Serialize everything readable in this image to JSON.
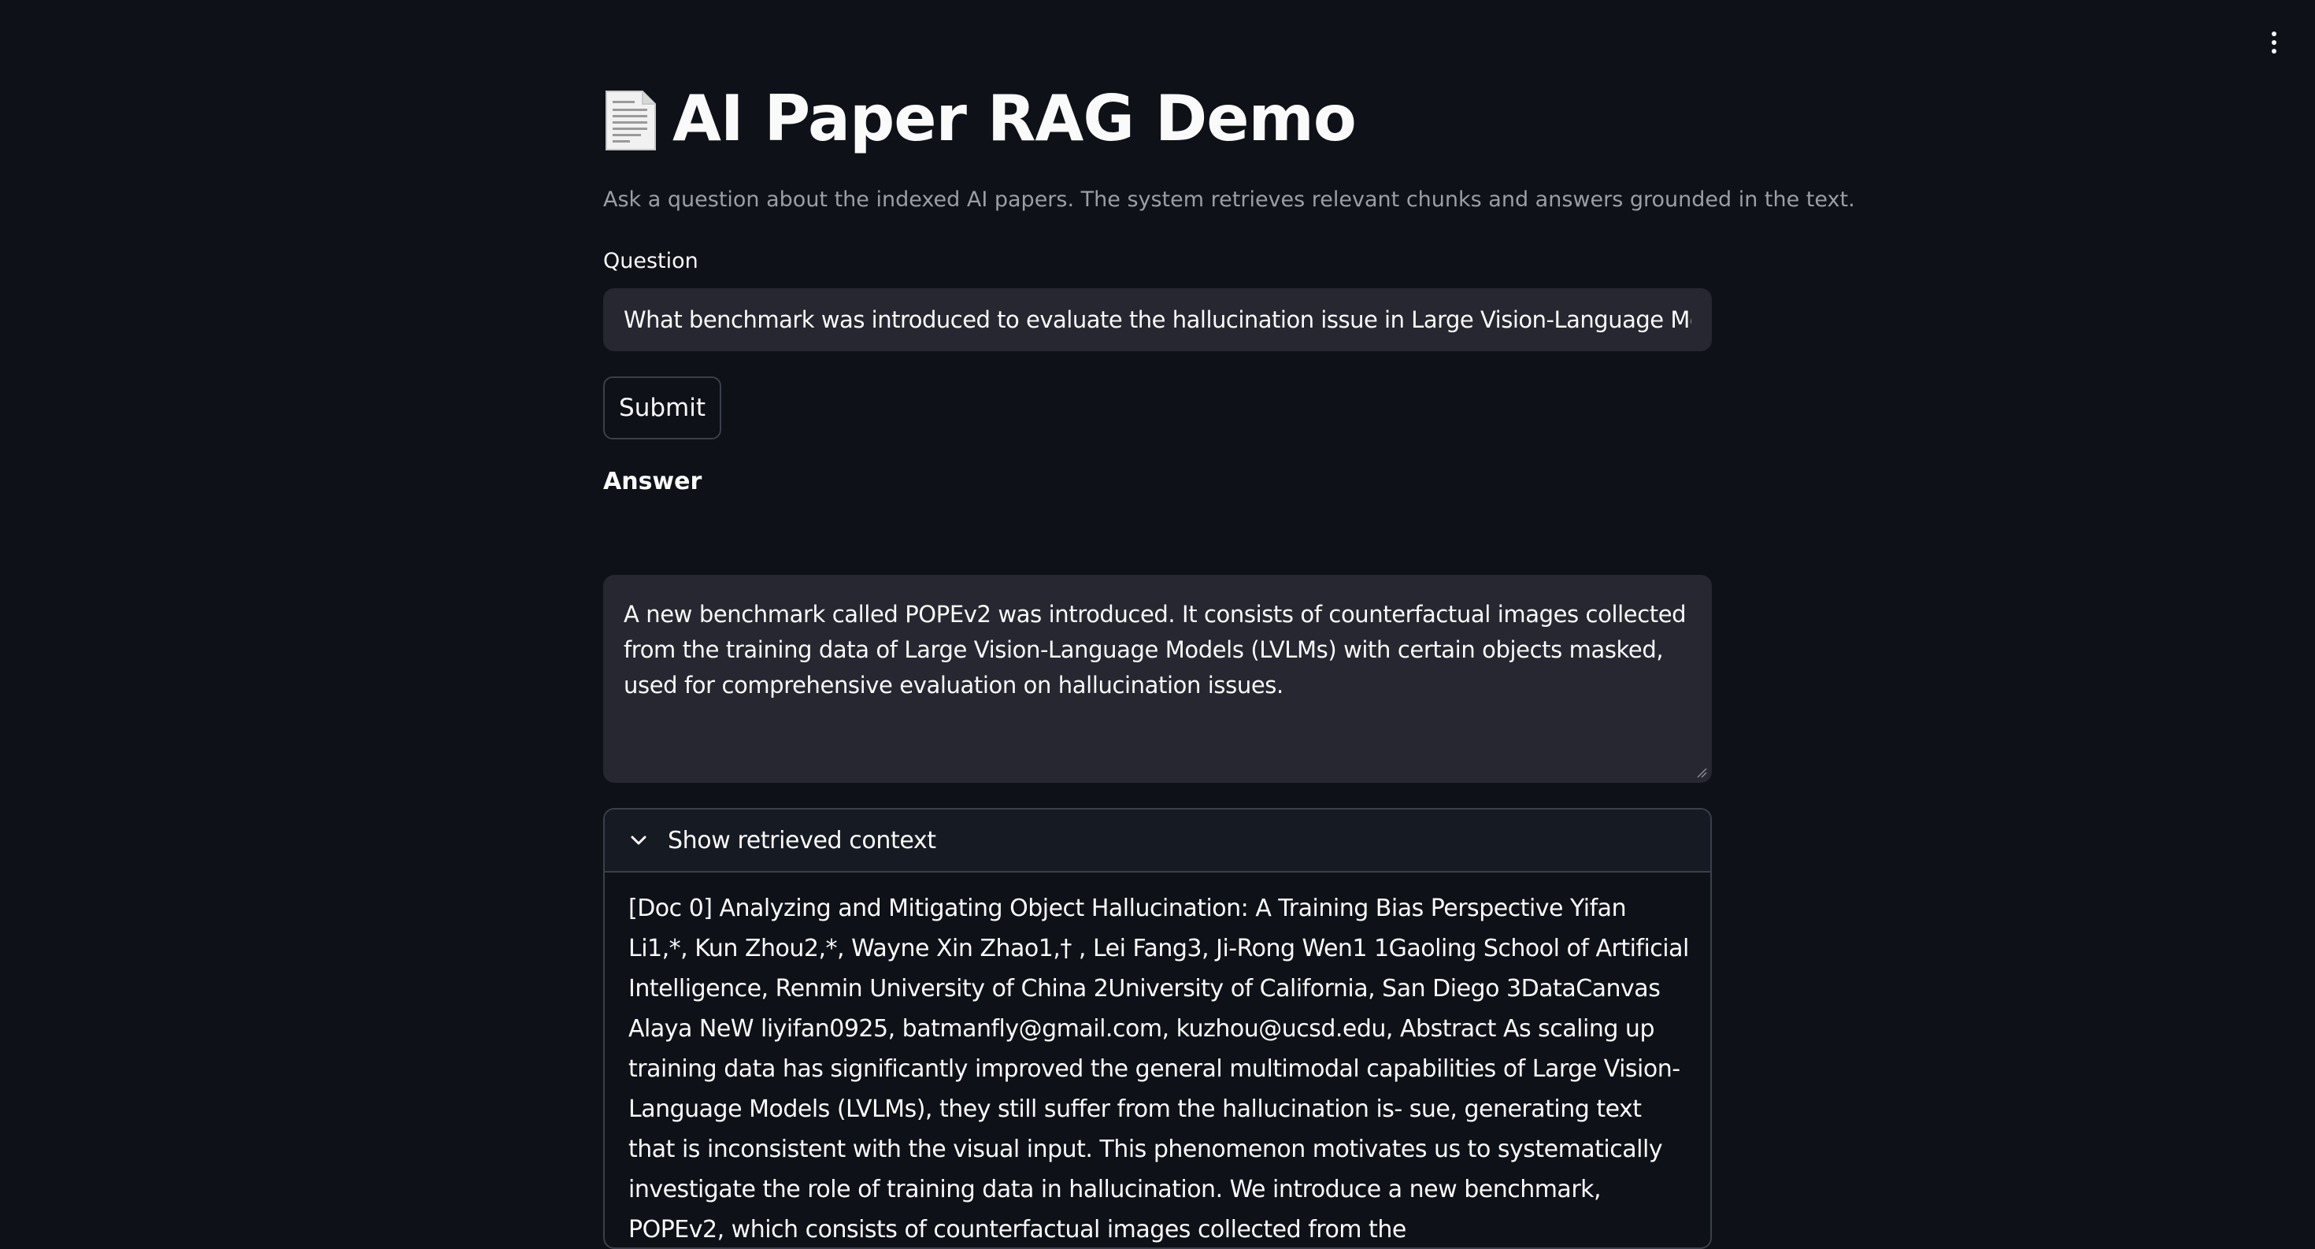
{
  "app": {
    "title": "AI Paper RAG Demo",
    "title_icon": "page-facing-up-icon",
    "subtitle": "Ask a question about the indexed AI papers. The system retrieves relevant chunks and answers grounded in the text.",
    "menu_icon": "vertical-ellipsis-icon"
  },
  "question": {
    "label": "Question",
    "value": "What benchmark was introduced to evaluate the hallucination issue in Large Vision-Language Models?"
  },
  "submit": {
    "label": "Submit"
  },
  "answer": {
    "heading": "Answer",
    "text": "A new benchmark called POPEv2 was introduced. It consists of counterfactual images collected from the training data of Large Vision-Language Models (LVLMs) with certain objects masked, used for comprehensive evaluation on hallucination issues."
  },
  "context": {
    "expander_label": "Show retrieved context",
    "chevron_icon": "chevron-down-icon",
    "text": "[Doc 0] Analyzing and Mitigating Object Hallucination: A Training Bias Perspective Yifan Li1,*, Kun Zhou2,*, Wayne Xin Zhao1,† , Lei Fang3, Ji-Rong Wen1 1Gaoling School of Artificial Intelligence, Renmin University of China 2University of California, San Diego 3DataCanvas Alaya NeW liyifan0925, batmanfly@gmail.com, kuzhou@ucsd.edu, Abstract As scaling up training data has significantly improved the general multimodal capabilities of Large Vision-Language Models (LVLMs), they still suffer from the hallucination is- sue, generating text that is inconsistent with the visual input. This phenomenon motivates us to systematically investigate the role of training data in hallucination. We introduce a new benchmark, POPEv2, which consists of counterfactual images collected from the"
  },
  "colors": {
    "background": "#0e1117",
    "input_background": "#262730",
    "border": "#3b3f4a",
    "text": "#fafafa",
    "muted_text": "#9b9ea5"
  }
}
